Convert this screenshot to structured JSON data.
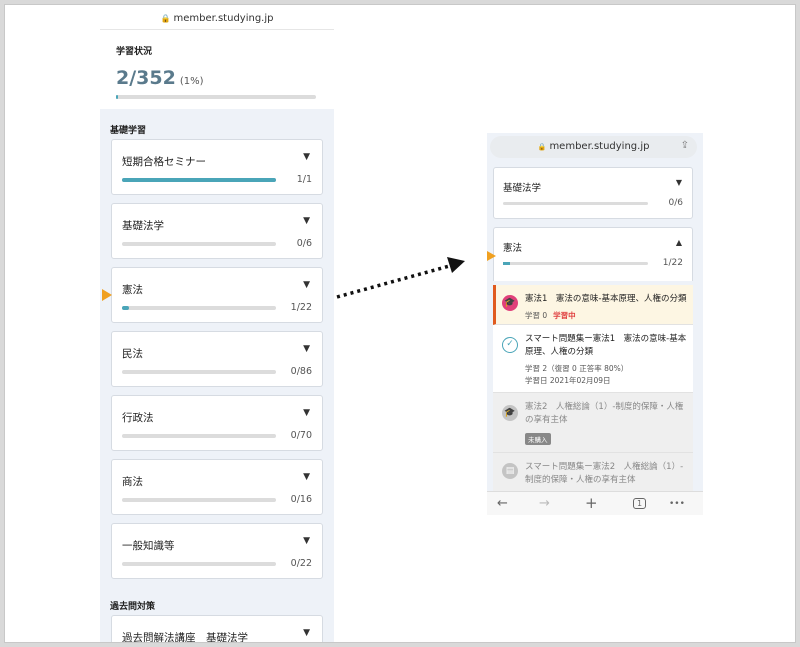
{
  "left_phone": {
    "url": "member.studying.jp",
    "status": {
      "label": "学習状況",
      "count": "2/352",
      "percent": "(1%)",
      "progress": 0.0057
    },
    "section_basic": "基礎学習",
    "courses": [
      {
        "title": "短期合格セミナー",
        "count": "1/1",
        "progress": 1.0
      },
      {
        "title": "基礎法学",
        "count": "0/6",
        "progress": 0
      },
      {
        "title": "憲法",
        "count": "1/22",
        "progress": 0.045
      },
      {
        "title": "民法",
        "count": "0/86",
        "progress": 0
      },
      {
        "title": "行政法",
        "count": "0/70",
        "progress": 0
      },
      {
        "title": "商法",
        "count": "0/16",
        "progress": 0
      },
      {
        "title": "一般知識等",
        "count": "0/22",
        "progress": 0
      }
    ],
    "section_past": "過去問対策",
    "past_course": {
      "title": "過去問解法講座　基礎法学"
    }
  },
  "right_phone": {
    "url": "member.studying.jp",
    "courses": [
      {
        "title": "基礎法学",
        "count": "0/6",
        "progress": 0
      },
      {
        "title": "憲法",
        "count": "1/22",
        "progress": 0.045
      }
    ],
    "lessons": [
      {
        "title": "憲法1　憲法の意味-基本原理、人権の分類",
        "meta": "学習 0",
        "tag": "学習中"
      },
      {
        "title": "スマート問題集ー憲法1　憲法の意味-基本原理、人権の分類",
        "meta1": "学習 2（復習 0  正答率 80%）",
        "meta2": "学習日  2021年02月09日"
      },
      {
        "title": "憲法2　人権総論（1）-制度的保障・人権の享有主体",
        "badge": "未購入"
      },
      {
        "title": "スマート問題集ー憲法2　人権総論（1）-制度的保障・人権の享有主体"
      }
    ],
    "nav": {
      "back": "←",
      "forward": "→",
      "new_tab": "+",
      "tabs": "1",
      "more": "•••"
    }
  },
  "colors": {
    "accent": "#4aa5b8",
    "marker": "#f0a020",
    "active_bg": "#fdf6e3",
    "active_border": "#e05a1e",
    "lesson_icon_pink": "#e0407a"
  }
}
